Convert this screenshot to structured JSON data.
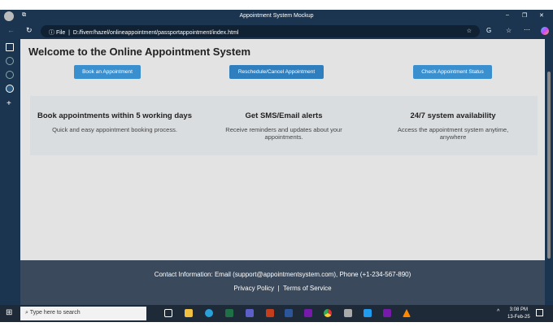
{
  "window": {
    "title": "Appointment System Mockup"
  },
  "address": {
    "scheme": "File",
    "url": "D:/fiverr/hazel/onlineappointment/passportappointment/index.html"
  },
  "page": {
    "heading": "Welcome to the Online Appointment System",
    "buttons": [
      "Book an Appointment",
      "Reschedule/Cancel Appointment",
      "Check Appointment Status"
    ],
    "features": [
      {
        "title": "Book appointments within 5 working days",
        "desc": "Quick and easy appointment booking process."
      },
      {
        "title": "Get SMS/Email alerts",
        "desc": "Receive reminders and updates about your appointments."
      },
      {
        "title": "24/7 system availability",
        "desc": "Access the appointment system anytime, anywhere"
      }
    ],
    "footer": {
      "contact": "Contact Information: Email (support@appointmentsystem.com), Phone (+1-234-567-890)",
      "privacy": "Privacy Policy",
      "sep": "|",
      "terms": "Terms of Service"
    }
  },
  "taskbar": {
    "search_placeholder": "Type here to search",
    "time": "3:08 PM",
    "date": "13-Feb-25"
  },
  "colors": {
    "accent": "#3a8fcf",
    "footer": "#3a4a5c",
    "chrome": "#1b3550"
  }
}
